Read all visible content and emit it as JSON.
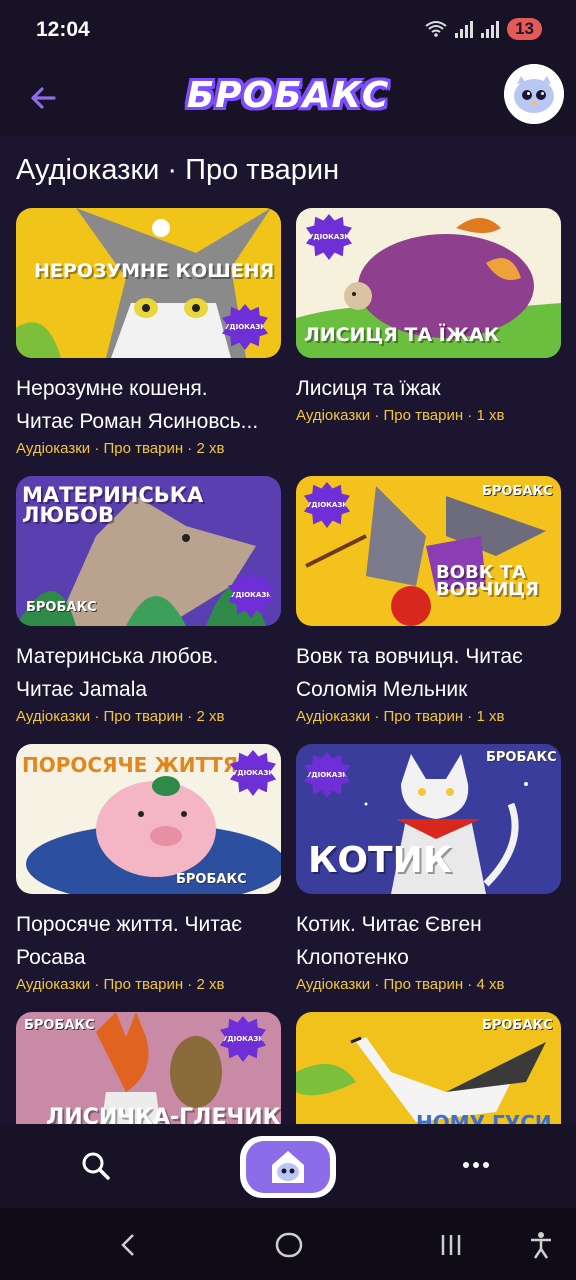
{
  "status_bar": {
    "time": "12:04",
    "battery": "13"
  },
  "header": {
    "logo_text": "БРОБАКС",
    "back_label": "Назад"
  },
  "page": {
    "title": "Аудіоказки · Про тварин"
  },
  "thumb_labels": {
    "badge": "АУДІОКАЗКА",
    "brand": "БРОБАКС"
  },
  "cards": [
    {
      "title_line1": "Нерозумне кошеня.",
      "title_line2": "Читає Роман Ясиновсь...",
      "meta": "Аудіоказки · Про тварин · 2 хв",
      "cover_text": "НЕРОЗУМНЕ КОШЕНЯ",
      "cover_color": "#f0c419"
    },
    {
      "title_line1": "Лисиця та їжак",
      "title_line2": "",
      "meta": "Аудіоказки · Про тварин · 1 хв",
      "cover_text": "ЛИСИЦЯ ТА ЇЖАК",
      "cover_color": "#f6f1dc"
    },
    {
      "title_line1": "Материнська любов.",
      "title_line2": "Читає Jamala",
      "meta": "Аудіоказки · Про тварин · 2 хв",
      "cover_text": "МАТЕРИНСЬКА ЛЮБОВ",
      "cover_color": "#5a3fb0"
    },
    {
      "title_line1": "Вовк та вовчиця. Читає",
      "title_line2": "Соломія Мельник",
      "meta": "Аудіоказки · Про тварин · 1 хв",
      "cover_text": "ВОВК ТА ВОВЧИЦЯ",
      "cover_color": "#f4c21c"
    },
    {
      "title_line1": "Поросяче життя. Читає",
      "title_line2": "Росава",
      "meta": "Аудіоказки · Про тварин · 2 хв",
      "cover_text": "ПОРОСЯЧЕ ЖИТТЯ",
      "cover_color": "#f7f3e4"
    },
    {
      "title_line1": "Котик. Читає Євген",
      "title_line2": "Клопотенко",
      "meta": "Аудіоказки · Про тварин · 4 хв",
      "cover_text": "КОТИК",
      "cover_color": "#3a3d9c"
    },
    {
      "title_line1": "",
      "title_line2": "",
      "meta": "",
      "cover_text": "ЛИСИЧКА-ГЛЕЧИК",
      "cover_color": "#c98aa6"
    },
    {
      "title_line1": "",
      "title_line2": "",
      "meta": "",
      "cover_text": "НОМУ ГУСИ",
      "cover_color": "#f1c21b"
    }
  ],
  "colors": {
    "background": "#1b1530",
    "meta_text": "#f3c73a",
    "accent": "#7c4dff"
  },
  "icons": {
    "back": "arrow-left-icon",
    "search": "search-icon",
    "home": "home-icon",
    "more": "more-dots-icon"
  }
}
